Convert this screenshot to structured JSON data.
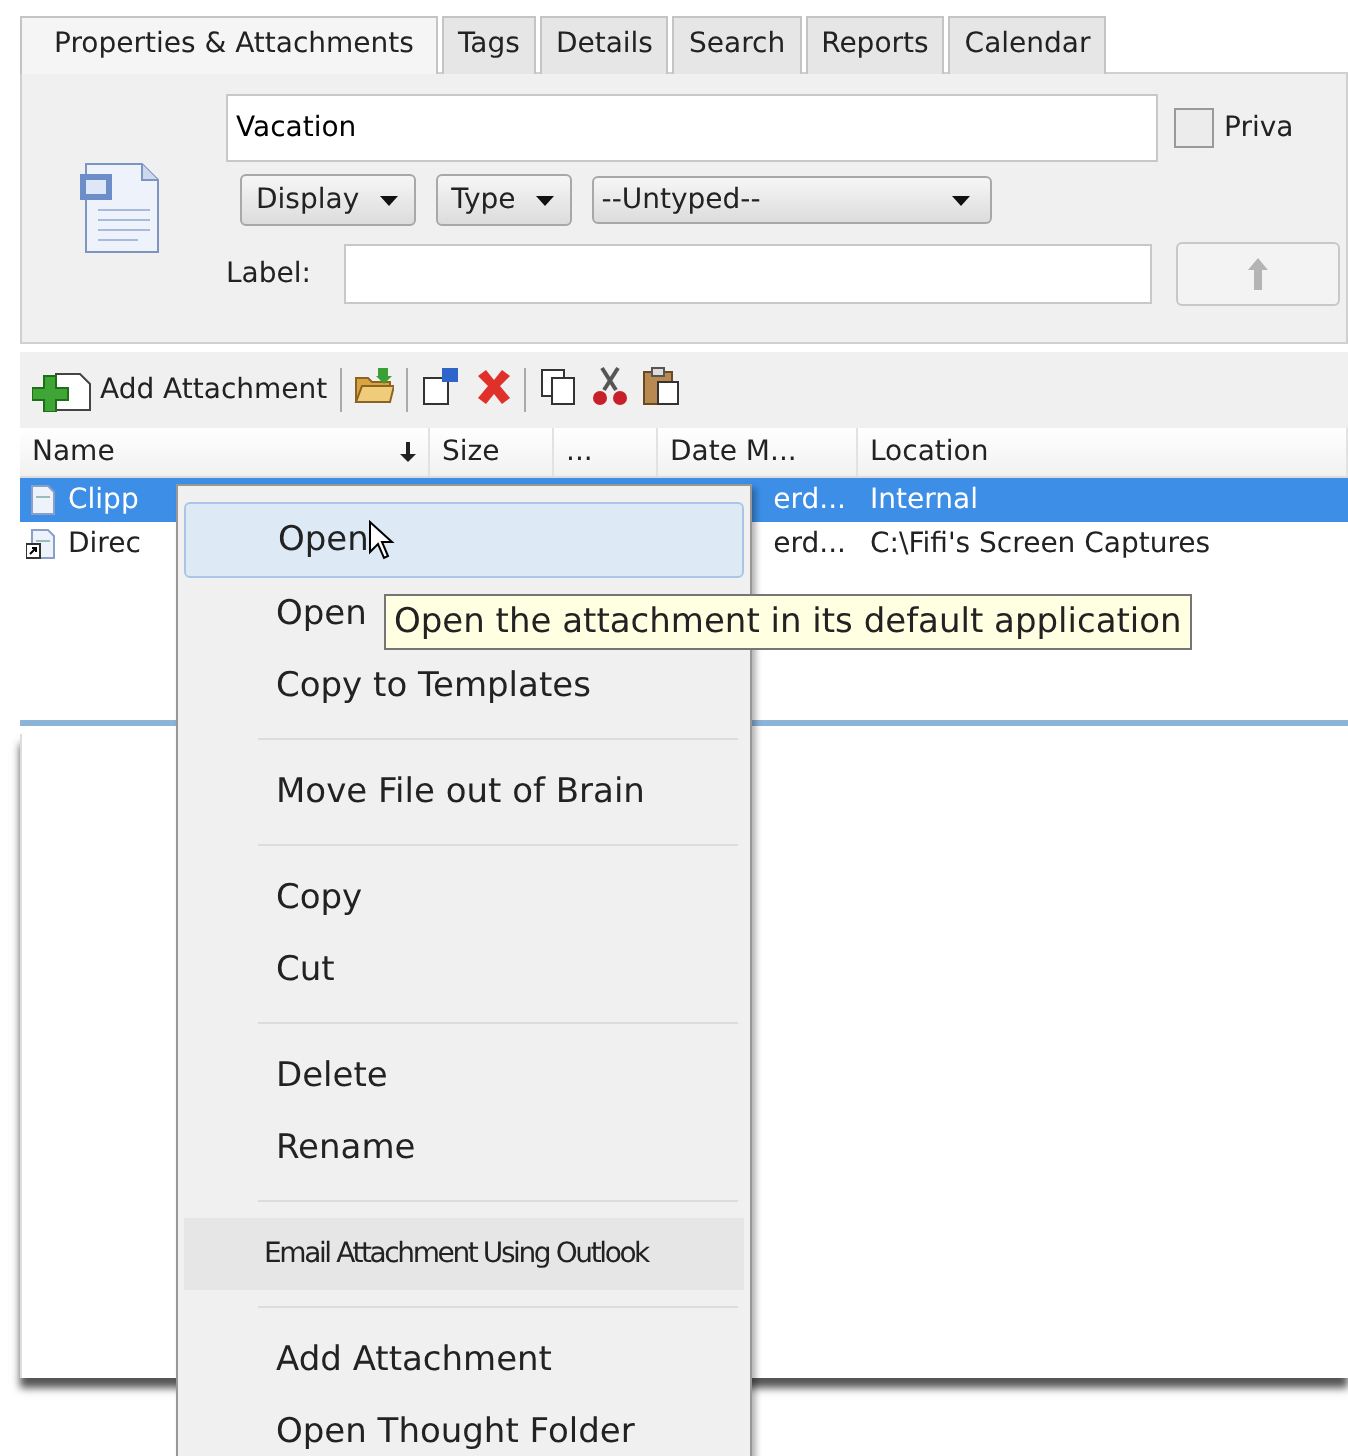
{
  "tabs": [
    {
      "label": "Properties & Attachments",
      "selected": true
    },
    {
      "label": "Tags",
      "selected": false
    },
    {
      "label": "Details",
      "selected": false
    },
    {
      "label": "Search",
      "selected": false
    },
    {
      "label": "Reports",
      "selected": false
    },
    {
      "label": "Calendar",
      "selected": false
    }
  ],
  "properties": {
    "name_value": "Vacation",
    "private": {
      "label": "Priva",
      "checked": false
    },
    "dropdowns": [
      {
        "label": "Display",
        "kind": "button"
      },
      {
        "label": "Type",
        "kind": "button"
      },
      {
        "label": "--Untyped--",
        "kind": "select"
      }
    ],
    "label_field": {
      "label": "Label:"
    }
  },
  "toolbar": [
    {
      "kind": "add",
      "label": "Add Attachment"
    },
    {
      "kind": "separator"
    },
    {
      "kind": "folder"
    },
    {
      "kind": "separator"
    },
    {
      "kind": "new"
    },
    {
      "kind": "delete"
    },
    {
      "kind": "separator"
    },
    {
      "kind": "copy"
    },
    {
      "kind": "cut"
    },
    {
      "kind": "paste"
    }
  ],
  "table": {
    "columns": [
      {
        "label": "Name",
        "sorted": true
      },
      {
        "label": "Size",
        "sorted": false
      },
      {
        "label": "...",
        "sorted": false
      },
      {
        "label": "Date M...",
        "sorted": false
      },
      {
        "label": "Location",
        "sorted": false
      }
    ],
    "rows": [
      {
        "kind": "file",
        "name": "Clipp",
        "date": "erd...",
        "location": "Internal",
        "selected": true
      },
      {
        "kind": "shortcut",
        "name": "Direc",
        "date": "erd...",
        "location": "C:\\Fifi's Screen Captures",
        "selected": false
      }
    ]
  },
  "context_menu": {
    "groups": [
      [
        {
          "label": "Open",
          "kind": "normal",
          "selected": true
        },
        {
          "label": "Open",
          "kind": "normal",
          "selected": false
        },
        {
          "label": "Copy to Templates",
          "kind": "normal",
          "selected": false
        }
      ],
      [
        {
          "label": "Move File out of Brain",
          "kind": "normal",
          "selected": false
        }
      ],
      [
        {
          "label": "Copy",
          "kind": "normal",
          "selected": false
        },
        {
          "label": "Cut",
          "kind": "normal",
          "selected": false
        }
      ],
      [
        {
          "label": "Delete",
          "kind": "normal",
          "selected": false
        },
        {
          "label": "Rename",
          "kind": "normal",
          "selected": false
        }
      ],
      [
        {
          "label": "Email Attachment Using Outlook",
          "kind": "condensed",
          "selected": false
        }
      ],
      [
        {
          "label": "Add Attachment",
          "kind": "normal",
          "selected": false
        },
        {
          "label": "Open Thought Folder",
          "kind": "normal",
          "selected": false
        }
      ]
    ]
  },
  "tooltip": {
    "text": "Open the attachment in its default application"
  }
}
